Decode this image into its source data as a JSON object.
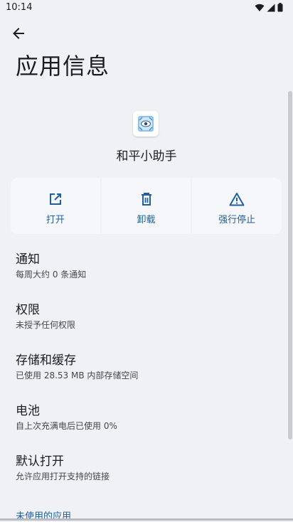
{
  "status_bar": {
    "time": "10:14",
    "icons": [
      "wifi-icon",
      "signal-icon",
      "battery-icon"
    ]
  },
  "header": {
    "back_icon": "arrow-back-icon",
    "title": "应用信息"
  },
  "app": {
    "name": "和平小助手",
    "icon": "app-icon"
  },
  "actions": [
    {
      "label": "打开",
      "icon": "open-external-icon"
    },
    {
      "label": "卸载",
      "icon": "trash-icon"
    },
    {
      "label": "强行停止",
      "icon": "warning-icon"
    }
  ],
  "settings": [
    {
      "title": "通知",
      "subtitle": "每周大约 0 条通知"
    },
    {
      "title": "权限",
      "subtitle": "未授予任何权限"
    },
    {
      "title": "存储和缓存",
      "subtitle": "已使用 28.53 MB 内部存储空间"
    },
    {
      "title": "电池",
      "subtitle": "自上次充满电后已使用 0%"
    },
    {
      "title": "默认打开",
      "subtitle": "允许应用打开支持的链接"
    }
  ],
  "section_header": "未使用的应用",
  "colors": {
    "background": "#eff1f5",
    "card": "#f6f7fb",
    "accent": "#1f5f9e",
    "text": "#1b1c1f",
    "subtext": "#42474e"
  }
}
